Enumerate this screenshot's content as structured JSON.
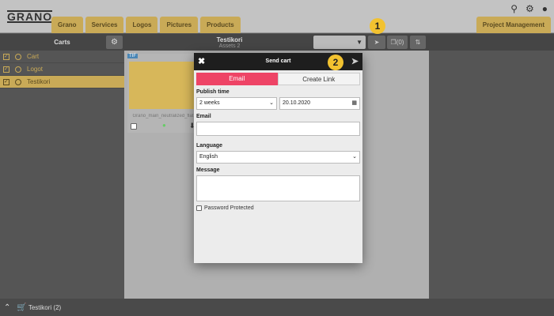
{
  "header": {
    "logo": "GRANO",
    "tabs": [
      "Grano",
      "Services",
      "Logos",
      "Pictures",
      "Products"
    ],
    "project_management": "Project Management",
    "icons": [
      "search-icon",
      "gear-icon",
      "user-icon"
    ]
  },
  "toolbar": {
    "carts_label": "Carts",
    "cart_title": "Testikori",
    "cart_subtitle": "Assets 2",
    "compare_count": "(0)"
  },
  "sidebar": {
    "items": [
      {
        "label": "Cart",
        "active": false
      },
      {
        "label": "Logot",
        "active": false
      },
      {
        "label": "Testikori",
        "active": true
      }
    ]
  },
  "asset": {
    "type": "TIF",
    "filename": "Grano_main_neutralized_flat"
  },
  "badges": [
    "1",
    "2"
  ],
  "modal": {
    "title": "Send cart",
    "tabs": [
      "Email",
      "Create Link"
    ],
    "active_tab": "Email",
    "publish_time_label": "Publish time",
    "publish_time_value": "2 weeks",
    "date_value": "20.10.2020",
    "email_label": "Email",
    "email_value": "",
    "language_label": "Language",
    "language_value": "English",
    "message_label": "Message",
    "message_value": "",
    "password_label": "Password Protected",
    "password_checked": false
  },
  "footer": {
    "cart": "Testikori (2)"
  },
  "colors": {
    "accent": "#c9aa57",
    "email_tab": "#ee4466",
    "badge": "#f2c230"
  }
}
